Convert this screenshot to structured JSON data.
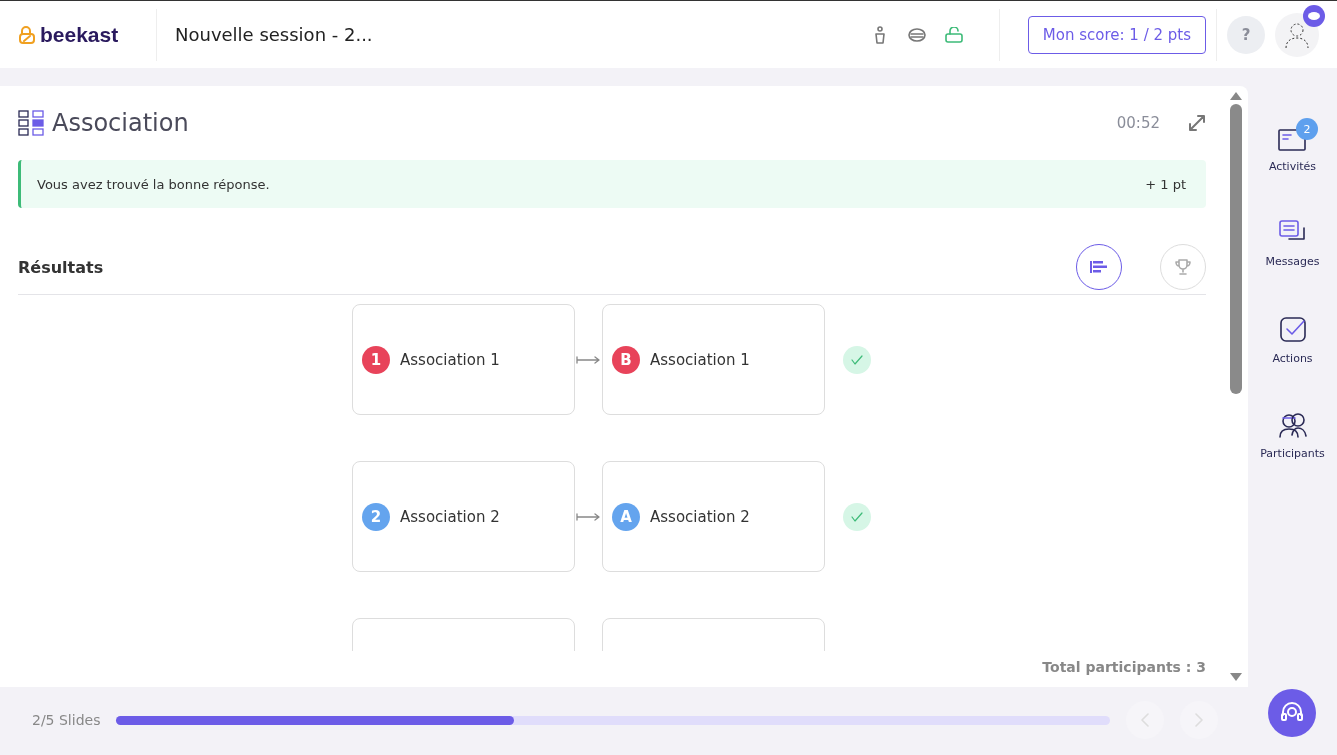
{
  "header": {
    "logo": "beekast",
    "session_title": "Nouvelle session - 2...",
    "score_button": "Mon score: 1 / 2 pts",
    "help_button": "?"
  },
  "activity": {
    "title": "Association",
    "timer": "00:52",
    "feedback": {
      "message": "Vous avez trouvé la bonne réponse.",
      "points": "+ 1 pt"
    },
    "results_title": "Résultats",
    "view_toggles": [
      {
        "kind": "list",
        "selected": true
      },
      {
        "kind": "trophy",
        "selected": false
      }
    ],
    "pairs": [
      {
        "kind": "pair",
        "correct": true,
        "left": {
          "marker": "1",
          "label": "Association 1",
          "color": "#e8435a"
        },
        "right": {
          "marker": "B",
          "label": "Association 1",
          "color": "#e8435a"
        }
      },
      {
        "kind": "pair",
        "correct": true,
        "left": {
          "marker": "2",
          "label": "Association 2",
          "color": "#64a4ee"
        },
        "right": {
          "marker": "A",
          "label": "Association 2",
          "color": "#64a4ee"
        }
      },
      {
        "kind": "clipped"
      }
    ],
    "total_participants": "Total participants : 3"
  },
  "sidebar": {
    "items": [
      {
        "kind": "activities",
        "label": "Activités",
        "count": "2"
      },
      {
        "kind": "messages",
        "label": "Messages"
      },
      {
        "kind": "actions",
        "label": "Actions"
      },
      {
        "kind": "participants",
        "label": "Participants"
      }
    ]
  },
  "footer": {
    "slides": "2/5 Slides",
    "progress": {
      "level": 0.4
    }
  }
}
